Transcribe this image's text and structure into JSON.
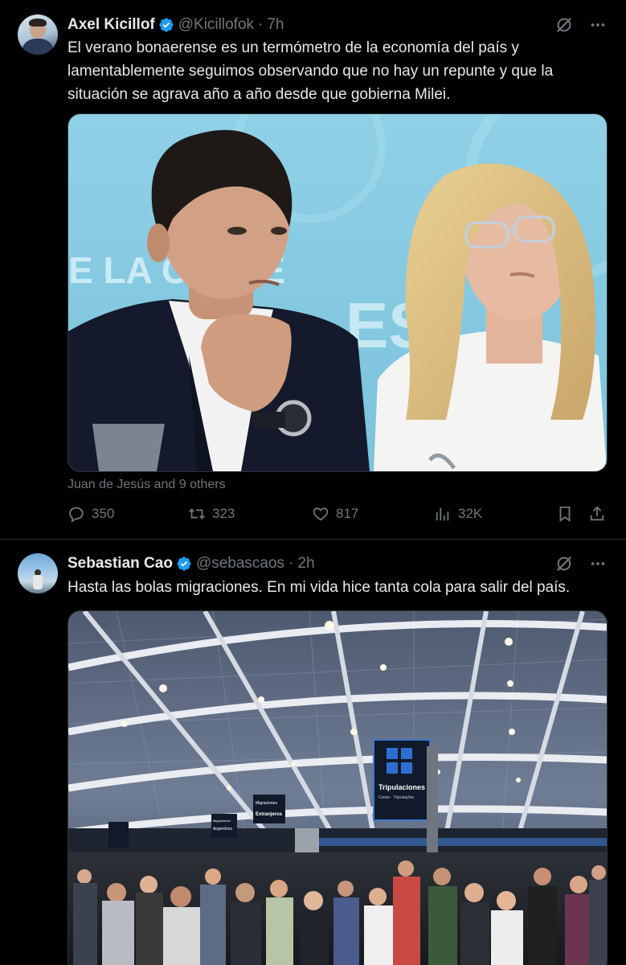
{
  "tweets": [
    {
      "name": "Axel Kicillof",
      "handle": "@Kicillofok",
      "separator": "·",
      "time": "7h",
      "text": "El verano bonaerense es un termómetro de la economía del país y lamentablemente seguimos observando que no hay un repunte y que la situación se agrava año a año desde que gobierna Milei.",
      "media_banner": "E LA   CIA DE",
      "media_banner_2": "ES",
      "tagged": "Juan de Jesús and 9 others",
      "stats": {
        "replies": "350",
        "reposts": "323",
        "likes": "817",
        "views": "32K"
      }
    },
    {
      "name": "Sebastian Cao",
      "handle": "@sebascaos",
      "separator": "·",
      "time": "2h",
      "text": "Hasta las bolas migraciones. En mi vida hice tanta cola para salir del país.",
      "sign_main_title": "Tripulaciones",
      "sign_main_sub": "Crews · Tripulações",
      "sign_left_1": "Migraciones",
      "sign_left_2": "Extranjeros",
      "sign_left_3": "Migraciones",
      "sign_left_4": "Argentinos"
    }
  ],
  "icons": [
    "verified-badge-icon",
    "grok-icon",
    "more-icon",
    "reply-icon",
    "repost-icon",
    "like-icon",
    "views-icon",
    "bookmark-icon",
    "share-icon"
  ],
  "colors": {
    "background": "#000000",
    "text": "#e7e9ea",
    "muted": "#71767b",
    "verified": "#1d9bf0",
    "divider": "#2f3336"
  }
}
